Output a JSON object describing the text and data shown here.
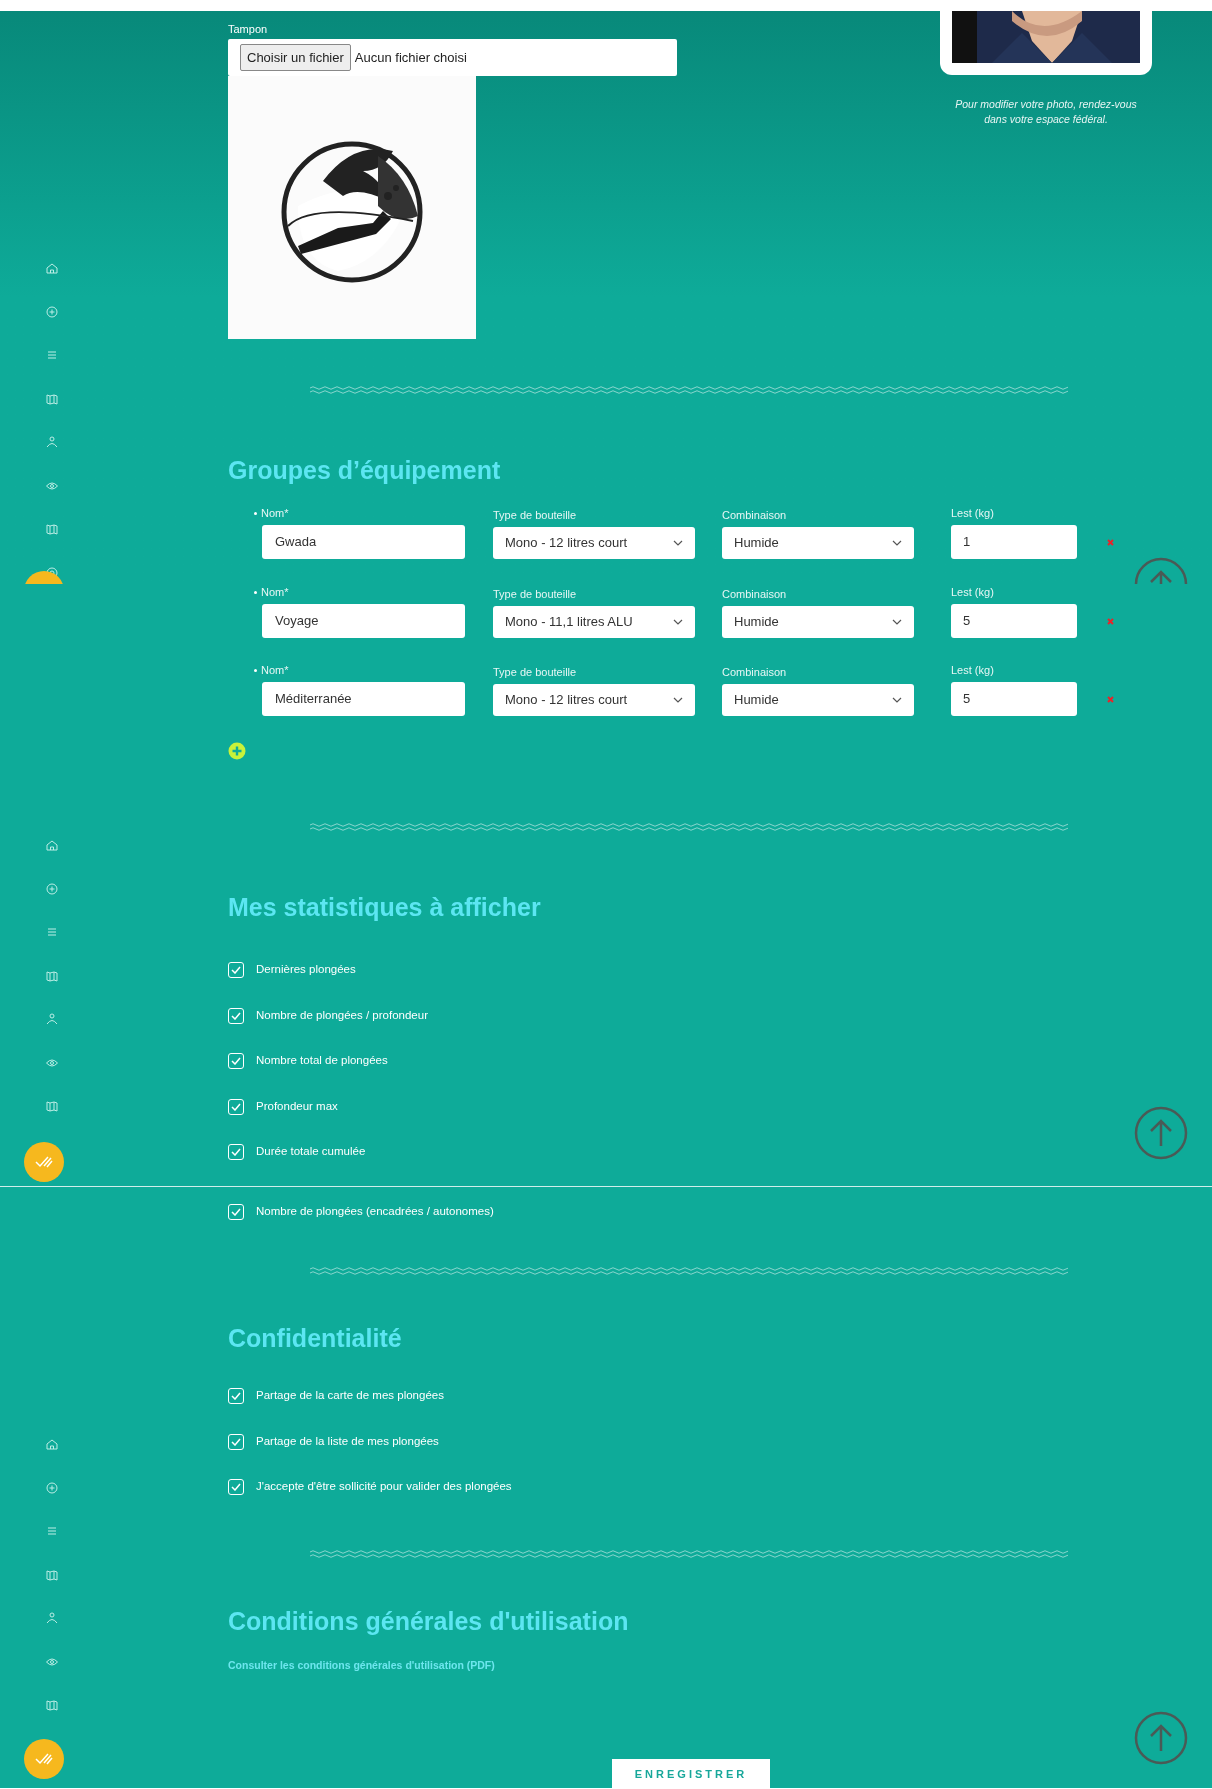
{
  "stamp": {
    "label": "Tampon",
    "button": "Choisir un fichier",
    "file_status": "Aucun fichier choisi"
  },
  "photo": {
    "caption": "Pour modifier votre photo, rendez-vous dans votre espace fédéral."
  },
  "equipment": {
    "title": "Groupes d’équipement",
    "rows": [
      {
        "name_label": "Nom*",
        "name": "Gwada",
        "bottle_label": "Type de bouteille",
        "bottle": "Mono - 12 litres court",
        "suit_label": "Combinaison",
        "suit": "Humide",
        "weight_label": "Lest (kg)",
        "weight": "1"
      },
      {
        "name_label": "Nom*",
        "name": "Voyage",
        "bottle_label": "Type de bouteille",
        "bottle": "Mono - 11,1 litres ALU",
        "suit_label": "Combinaison",
        "suit": "Humide",
        "weight_label": "Lest (kg)",
        "weight": "5"
      },
      {
        "name_label": "Nom*",
        "name": "Méditerranée",
        "bottle_label": "Type de bouteille",
        "bottle": "Mono - 12 litres court",
        "suit_label": "Combinaison",
        "suit": "Humide",
        "weight_label": "Lest (kg)",
        "weight": "5"
      }
    ]
  },
  "statistics": {
    "title": "Mes statistiques à afficher",
    "items": [
      {
        "label": "Dernières plongées",
        "checked": true
      },
      {
        "label": "Nombre de plongées / profondeur",
        "checked": true
      },
      {
        "label": "Nombre total de plongées",
        "checked": true
      },
      {
        "label": "Profondeur max",
        "checked": true
      },
      {
        "label": "Durée totale cumulée",
        "checked": true
      },
      {
        "label": "Nombre de plongées (encadrées / autonomes)",
        "checked": true
      }
    ]
  },
  "privacy": {
    "title": "Confidentialité",
    "items": [
      {
        "label": "Partage de la carte de mes plongées",
        "checked": true
      },
      {
        "label": "Partage de la liste de mes plongées",
        "checked": true
      },
      {
        "label": "J'accepte d'être sollicité pour valider des plongées",
        "checked": true
      }
    ]
  },
  "terms": {
    "title": "Conditions générales d'utilisation",
    "link": "Consulter les conditions générales d'utilisation (PDF)"
  },
  "save_button": "ENREGISTRER"
}
